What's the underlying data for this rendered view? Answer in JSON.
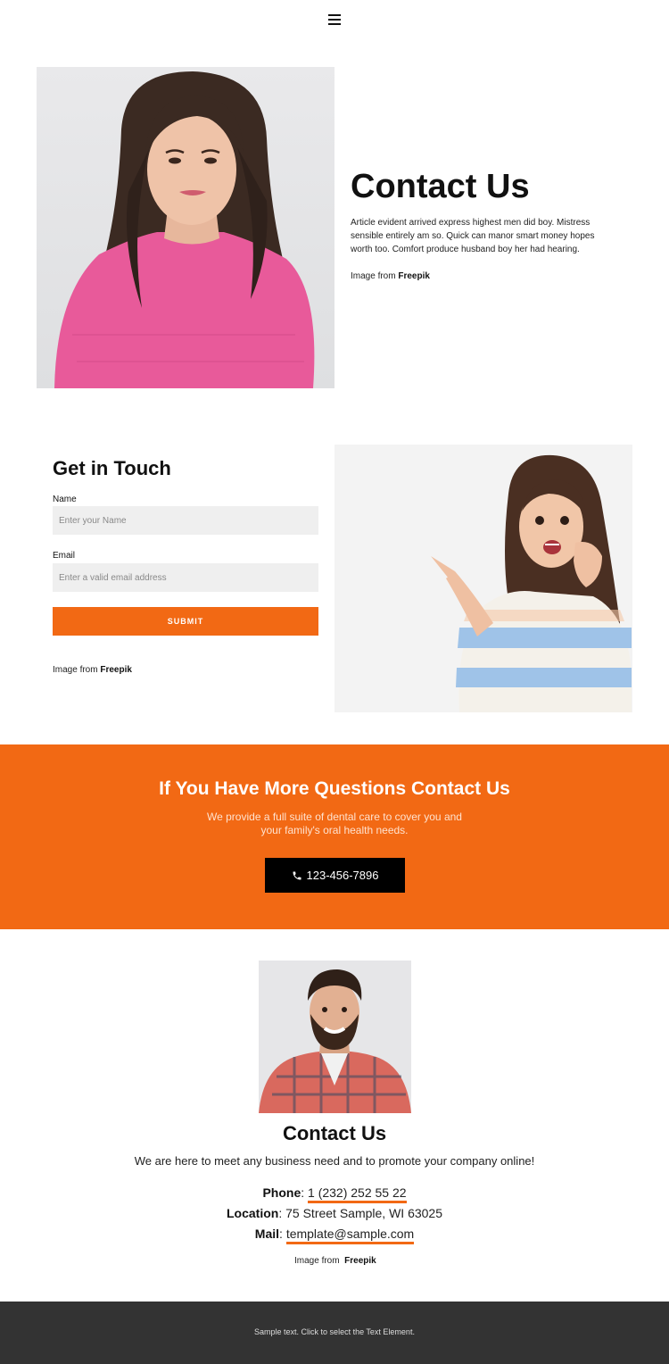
{
  "header": {
    "menu_icon": "hamburger-icon"
  },
  "hero": {
    "title": "Contact Us",
    "text": "Article evident arrived express highest men did boy. Mistress sensible entirely am so. Quick can manor smart money hopes worth too. Comfort produce husband boy her had hearing.",
    "credit_prefix": "Image from",
    "credit_source": "Freepik"
  },
  "form": {
    "title": "Get in Touch",
    "name_label": "Name",
    "name_placeholder": "Enter your Name",
    "email_label": "Email",
    "email_placeholder": "Enter a valid email address",
    "submit_label": "SUBMIT",
    "credit_prefix": "Image from",
    "credit_source": "Freepik"
  },
  "band": {
    "title": "If You Have More Questions Contact Us",
    "text": "We provide a full suite of dental care to cover you and your family's oral health needs.",
    "phone_label": "123-456-7896",
    "phone_icon": "phone-icon"
  },
  "contact": {
    "title": "Contact Us",
    "text": "We are here to meet any business need and to promote your company online!",
    "phone_label": "Phone",
    "phone_value": "1 (232) 252 55 22",
    "location_label": "Location",
    "location_value": "75 Street Sample, WI 63025",
    "mail_label": "Mail",
    "mail_value": "template@sample.com",
    "credit_prefix": "Image from",
    "credit_source": "Freepik"
  },
  "footer": {
    "text": "Sample text. Click to select the Text Element."
  },
  "colors": {
    "accent": "#f26914",
    "footer_bg": "#333333",
    "button_dark": "#000000"
  }
}
